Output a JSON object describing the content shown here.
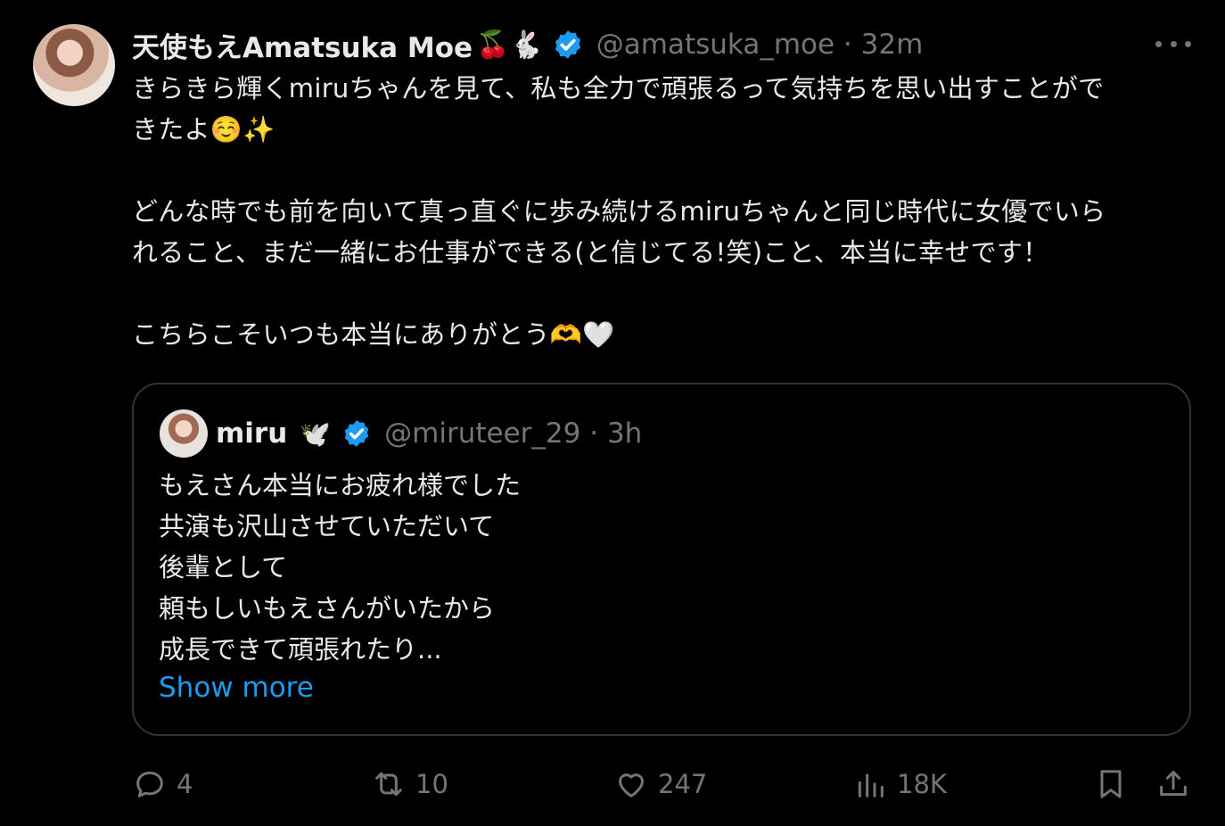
{
  "tweet": {
    "display_name": "天使もえAmatsuka Moe",
    "name_emojis": "🍒🐇",
    "handle": "@amatsuka_moe",
    "time": "32m",
    "text": "きらきら輝くmiruちゃんを見て、私も全力で頑張るって気持ちを思い出すことがで\nきたよ☺️✨\n\nどんな時でも前を向いて真っ直ぐに歩み続けるmiruちゃんと同じ時代に女優でいら\nれること、まだ一緒にお仕事ができる(と信じてる!笑)こと、本当に幸せです！\n\nこちらこそいつも本当にありがとう🫶🤍"
  },
  "quote": {
    "display_name": "miru",
    "name_emoji": "🕊️",
    "handle": "@miruteer_29",
    "time": "3h",
    "text": "もえさん本当にお疲れ様でした\n共演も沢山させていただいて\n後輩として\n頼もしいもえさんがいたから\n成長できて頑張れたり...",
    "show_more": "Show more"
  },
  "actions": {
    "replies": "4",
    "reposts": "10",
    "likes": "247",
    "views": "18K"
  },
  "colors": {
    "background": "#000000",
    "text": "#e7e9ea",
    "muted": "#71767b",
    "accent": "#1d9bf0",
    "border": "#2f3336"
  },
  "icons": [
    "more-icon",
    "verified-badge-icon",
    "reply-icon",
    "repost-icon",
    "like-icon",
    "views-icon",
    "bookmark-icon",
    "share-icon"
  ]
}
